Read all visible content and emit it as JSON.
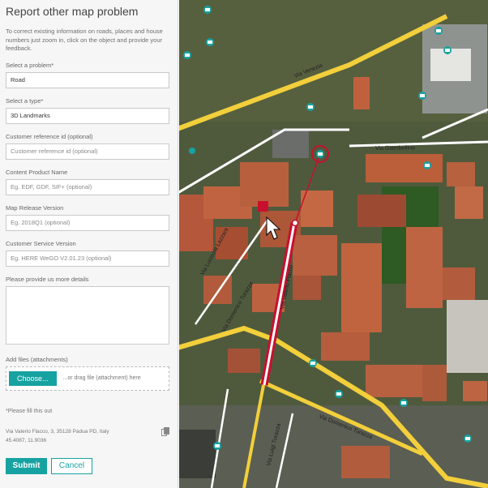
{
  "form": {
    "title": "Report other map problem",
    "intro": "To correct existing information on roads, places and house numbers just zoom in, click on the object and provide your feedback.",
    "problem_label": "Select a problem*",
    "problem_value": "Road",
    "type_label": "Select a type*",
    "type_value": "3D Landmarks",
    "customer_ref_label": "Customer reference id (optional)",
    "customer_ref_placeholder": "Customer reference id (optional)",
    "content_product_label": "Content Product Name",
    "content_product_placeholder": "Eg. EDF, GDF, SIF+ (optional)",
    "map_release_label": "Map Release Version",
    "map_release_placeholder": "Eg. 2018Q1 (optional)",
    "service_version_label": "Customer Service Version",
    "service_version_placeholder": "Eg. HERE WeGO V2.01.23 (optional)",
    "details_label": "Please provide us more details",
    "details_value": "",
    "files_label": "Add files (attachments)",
    "choose_label": "Choose...",
    "drop_hint": "...or drag file (attachment) here",
    "required_note": "*Please fill this out",
    "address_line": "Via Valerio Flacco, 3, 35128 Padua PD, Italy",
    "coords_line": "45.4087, 11.9036",
    "copy_icon": "copy-icon",
    "submit_label": "Submit",
    "cancel_label": "Cancel"
  },
  "map": {
    "streets": {
      "via_venezia": "Via Venezia",
      "via_giambellino": "Via Giambellino",
      "via_valerio_flacco": "Via Valerio Flacco",
      "via_domenico_turazza": "Via Domenico Turazza",
      "via_luigi_turazza": "Via Luigi Turazza",
      "via_lucrezia_lazzara": "Via Lucrezia Lazzara",
      "via_domenico_turazza_short": "Via Domenico Turazza"
    },
    "accent_color": "#17a2a2",
    "highlight_color": "#c8102e",
    "road_color": "#f2cf3b"
  }
}
